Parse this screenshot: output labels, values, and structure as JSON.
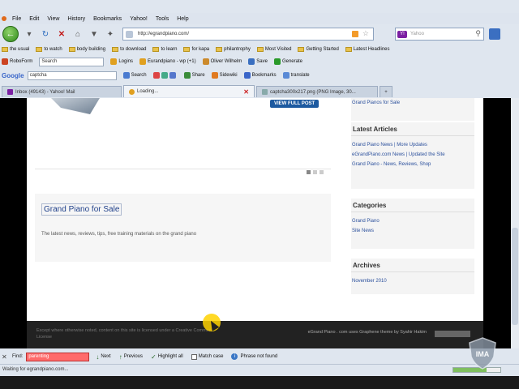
{
  "browser": {
    "menu": [
      "File",
      "Edit",
      "View",
      "History",
      "Bookmarks",
      "Yahoo!",
      "Tools",
      "Help"
    ],
    "url": "http://egrandpiano.com/",
    "search_placeholder": "Yahoo",
    "bookmarks": [
      "the usual",
      "to watch",
      "body building",
      "to download",
      "to learn",
      "for kapa",
      "philantrophy",
      "Most Visited",
      "Getting Started",
      "Latest Headlines"
    ],
    "toolbar1": {
      "roboform": "RoboForm",
      "search_value": "Search",
      "logins": "Logins",
      "extra": "Eurandpiano - wp (+1)",
      "oliver": "Oliver Wilhelm",
      "save": "Save",
      "generate": "Generate"
    },
    "toolbar2": {
      "google": "Google",
      "query": "captcha",
      "search_btn": "Search",
      "share": "Share",
      "sidewiki": "Sidewiki",
      "bookmarks": "Bookmarks",
      "translate": "translate"
    },
    "tabs": [
      {
        "label": "Inbox (49143) - Yahoo! Mail",
        "active": false
      },
      {
        "label": "Loading...",
        "active": true
      },
      {
        "label": "captcha300x217.png (PNG Image, 30...",
        "active": false
      }
    ],
    "find": {
      "label": "Find:",
      "value": "parenting",
      "next": "Next",
      "previous": "Previous",
      "highlight": "Highlight all",
      "match_case": "Match case",
      "message": "Phrase not found"
    },
    "status": "Waiting for egrandpiano.com...",
    "load_progress": 0.7
  },
  "page": {
    "view_post": "VIEW FULL POST",
    "post_title": "Grand Piano for Sale",
    "post_excerpt": "The latest news, reviews, tips, free training materials on the grand piano",
    "sidebar": {
      "top_link": "Grand Pianos for Sale",
      "latest_title": "Latest Articles",
      "latest": [
        "Grand Piano News | More Updates",
        "eGrandPiano.com News | Updated the Site",
        "Grand Piano - News, Reviews, Shop"
      ],
      "categories_title": "Categories",
      "categories": [
        "Grand Piano",
        "Site News"
      ],
      "archives_title": "Archives",
      "archives": [
        "November 2010"
      ]
    },
    "footer_left": "Except where otherwise noted, content on this site is licensed under a Creative Commons License",
    "footer_right": "eGrand Piano . com uses Graphene theme by Syahir Hakim"
  },
  "watermark": "IMA",
  "colors": {
    "accent": "#1e3f8a",
    "find_error": "#ff6b6b",
    "cursor_halo": "#ffd200"
  }
}
